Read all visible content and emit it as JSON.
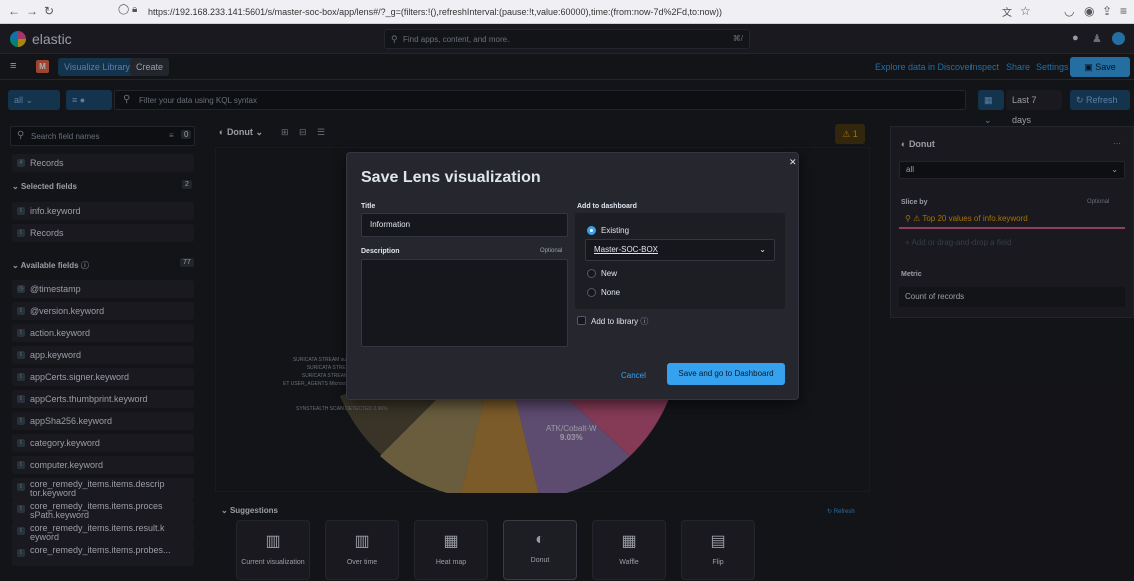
{
  "browser": {
    "url": "https://192.168.233.141:5601/s/master-soc-box/app/lens#/?_g=(filters:!(),refreshInterval:(pause:!t,value:60000),time:(from:now-7d%2Fd,to:now))"
  },
  "header": {
    "brand": "elastic",
    "search_placeholder": "Find apps, content, and more.",
    "search_shortcut": "⌘/",
    "space_initial": "M",
    "breadcrumbs": [
      "Visualize Library",
      "Create"
    ],
    "actions": [
      "Explore data in Discover",
      "Inspect",
      "Share",
      "Settings"
    ],
    "save_label": "Save"
  },
  "query": {
    "dataview": "all",
    "placeholder": "Filter your data using KQL syntax",
    "timerange": "Last 7 days",
    "refresh_label": "Refresh"
  },
  "sidebar": {
    "search_placeholder": "Search field names",
    "filter_count": "0",
    "records": "Records",
    "selected_header": "Selected fields",
    "selected_count": "2",
    "selected": [
      "info.keyword",
      "Records"
    ],
    "available_header": "Available fields",
    "available_count": "77",
    "available": [
      "@timestamp",
      "@version.keyword",
      "action.keyword",
      "app.keyword",
      "appCerts.signer.keyword",
      "appCerts.thumbprint.keyword",
      "appSha256.keyword",
      "category.keyword",
      "computer.keyword",
      "core_remedy_items.items.descrip tor.keyword",
      "core_remedy_items.items.proces sPath.keyword",
      "core_remedy_items.items.result.k eyword",
      "core_remedy_items.items.probes..."
    ]
  },
  "workspace": {
    "chart_type": "Donut",
    "warning_count": "1",
    "slice_labels": [
      "SURICATA STREAM suspected RS...",
      "SURICATA STREAM bad win...",
      "SURICATA STREAM FIN FIN w...",
      "ET USER_AGENTS Microsoft Device M...",
      "SYNSTEALTH SCAN DETECTED 2.96%"
    ],
    "pie_label": "ATK/Cobalt-W",
    "pie_pct": "9.03%"
  },
  "suggestions": {
    "header": "Suggestions",
    "refresh": "Refresh",
    "cards": [
      "Current visualization",
      "Over time",
      "Heat map",
      "Donut",
      "Waffle",
      "Flip"
    ]
  },
  "config": {
    "title": "Donut",
    "layer": "all",
    "slice_by": "Slice by",
    "slice_optional": "Optional",
    "slice_value": "Top 20 values of info.keyword",
    "add_field": "Add or drag-and-drop a field",
    "metric": "Metric",
    "metric_value": "Count of records"
  },
  "modal": {
    "heading": "Save Lens visualization",
    "title_label": "Title",
    "title_value": "Information",
    "description_label": "Description",
    "description_optional": "Optional",
    "dashboard_label": "Add to dashboard",
    "option_existing": "Existing",
    "dashboard_selected": "Master-SOC-BOX",
    "option_new": "New",
    "option_none": "None",
    "library_label": "Add to library",
    "cancel": "Cancel",
    "confirm": "Save and go to Dashboard"
  }
}
